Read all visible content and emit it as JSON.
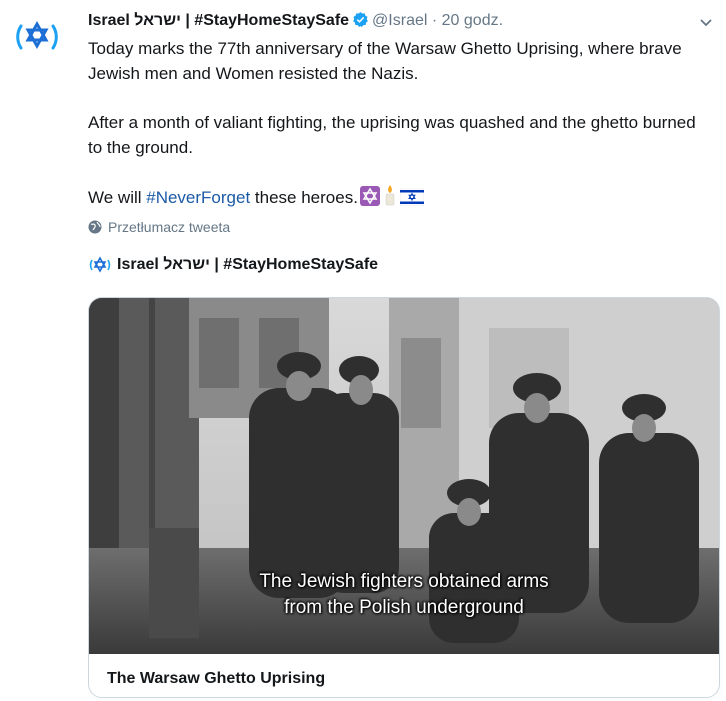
{
  "tweet": {
    "author_name": "Israel ישראל | #StayHomeStaySafe",
    "handle": "@Israel",
    "separator": "·",
    "time": "20 godz.",
    "paragraph1": "Today marks the 77th anniversary of the Warsaw Ghetto Uprising, where brave Jewish men and Women resisted the Nazis.",
    "paragraph2": "After a month of valiant fighting, the uprising was quashed and the ghetto burned to the ground.",
    "paragraph3_prefix": "We will ",
    "paragraph3_hashtag": "#NeverForget",
    "paragraph3_suffix": " these heroes.",
    "emojis": [
      "star-of-david",
      "candle",
      "israel-flag"
    ],
    "translate_label": "Przetłumacz tweeta"
  },
  "quoted": {
    "author_name": "Israel ישראל | #StayHomeStaySafe",
    "video_caption_line1": "The Jewish fighters obtained arms",
    "video_caption_line2": "from the Polish underground",
    "card_title": "The Warsaw Ghetto Uprising"
  },
  "colors": {
    "accent": "#1da1f2",
    "hashtag": "#1b5aa6",
    "muted": "#657786",
    "israel_blue": "#0038b8"
  }
}
